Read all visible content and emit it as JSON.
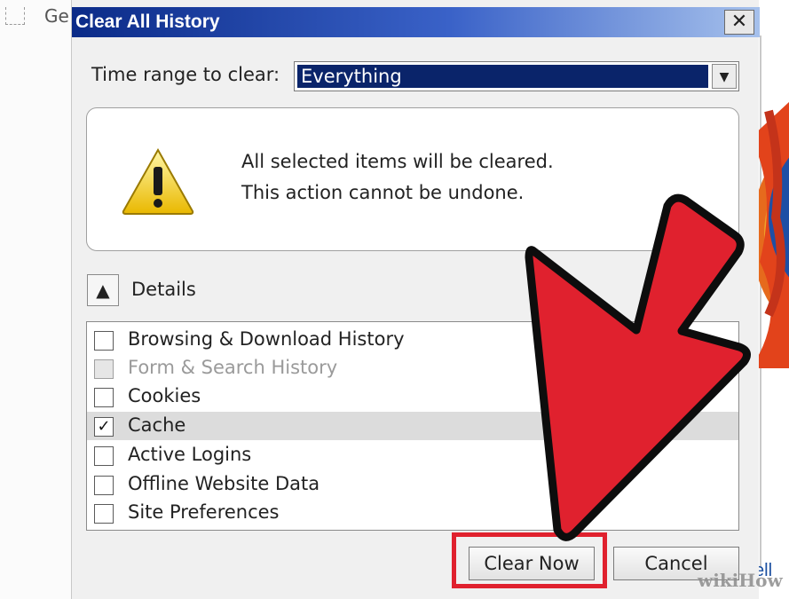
{
  "background": {
    "tab_fragment": "Ge",
    "link_fragment": "ell"
  },
  "dialog": {
    "title": "Clear All History",
    "close_glyph": "✕",
    "time_range_label": "Time range to clear:",
    "time_range_value": "Everything",
    "warning": {
      "icon": "warning-icon",
      "line1": "All selected items will be cleared.",
      "line2": "This action cannot be undone."
    },
    "details_toggle_glyph": "▲",
    "details_label": "Details",
    "items": [
      {
        "label": "Browsing & Download History",
        "checked": false,
        "disabled": false,
        "selected": false
      },
      {
        "label": "Form & Search History",
        "checked": false,
        "disabled": true,
        "selected": false
      },
      {
        "label": "Cookies",
        "checked": false,
        "disabled": false,
        "selected": false
      },
      {
        "label": "Cache",
        "checked": true,
        "disabled": false,
        "selected": true
      },
      {
        "label": "Active Logins",
        "checked": false,
        "disabled": false,
        "selected": false
      },
      {
        "label": "Offline Website Data",
        "checked": false,
        "disabled": false,
        "selected": false
      },
      {
        "label": "Site Preferences",
        "checked": false,
        "disabled": false,
        "selected": false
      }
    ],
    "buttons": {
      "clear_now": "Clear Now",
      "cancel": "Cancel"
    }
  },
  "overlay": {
    "arrow_color": "#e0212e",
    "highlight_color": "#e0212e",
    "watermark": "wikiHow"
  }
}
